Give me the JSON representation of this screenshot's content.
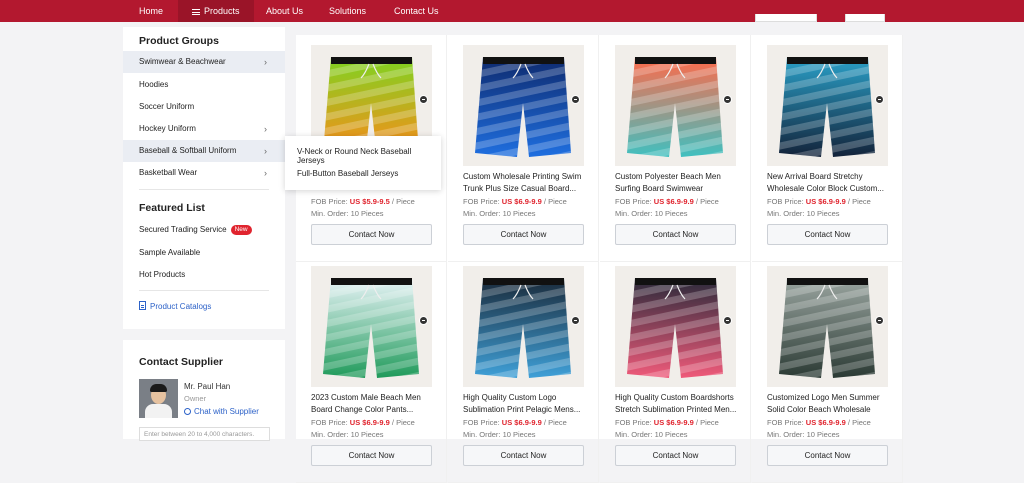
{
  "nav": {
    "items": [
      {
        "label": "Home",
        "active": false
      },
      {
        "label": "Products",
        "active": true
      },
      {
        "label": "About Us",
        "active": false
      },
      {
        "label": "Solutions",
        "active": false
      },
      {
        "label": "Contact Us",
        "active": false
      }
    ]
  },
  "sidebar": {
    "groups_title": "Product Groups",
    "groups": [
      {
        "label": "Swimwear & Beachwear",
        "has_sub": true
      },
      {
        "label": "Hoodies",
        "has_sub": false
      },
      {
        "label": "Soccer Uniform",
        "has_sub": false
      },
      {
        "label": "Hockey Uniform",
        "has_sub": true
      },
      {
        "label": "Baseball & Softball Uniform",
        "has_sub": true
      },
      {
        "label": "Basketball Wear",
        "has_sub": true
      }
    ],
    "flyout": [
      "V-Neck or Round Neck Baseball Jerseys",
      "Full-Button Baseball Jerseys"
    ],
    "featured_title": "Featured List",
    "featured": [
      {
        "label": "Secured Trading Service",
        "badge": "New"
      },
      {
        "label": "Sample Available",
        "badge": ""
      },
      {
        "label": "Hot Products",
        "badge": ""
      }
    ],
    "catalog_link": "Product Catalogs"
  },
  "contact": {
    "title": "Contact Supplier",
    "name": "Mr. Paul Han",
    "role": "Owner",
    "chat": "Chat with Supplier",
    "placeholder": "Enter between 20 to 4,000 characters."
  },
  "products": [
    {
      "title": "",
      "fob_label": "FOB Price:",
      "price": "US $5.9-9.5",
      "unit": "/ Piece",
      "moq": "Min. Order: 10 Pieces",
      "button": "Contact Now",
      "colors": [
        "#ff8a1a",
        "#7ed321"
      ]
    },
    {
      "title": "Custom Wholesale Printing Swim Trunk Plus Size Casual Board...",
      "fob_label": "FOB Price:",
      "price": "US $6.9-9.9",
      "unit": "/ Piece",
      "moq": "Min. Order: 10 Pieces",
      "button": "Contact Now",
      "colors": [
        "#1f6fe0",
        "#0e2a6e"
      ]
    },
    {
      "title": "Custom Polyester Beach Men Surfing Board Swimwear Swimsui...",
      "fob_label": "FOB Price:",
      "price": "US $6.9-9.9",
      "unit": "/ Piece",
      "moq": "Min. Order: 10 Pieces",
      "button": "Contact Now",
      "colors": [
        "#3fc0c0",
        "#ff6a4a"
      ]
    },
    {
      "title": "New Arrival Board Stretchy Wholesale Color Block Custom...",
      "fob_label": "FOB Price:",
      "price": "US $6.9-9.9",
      "unit": "/ Piece",
      "moq": "Min. Order: 10 Pieces",
      "button": "Contact Now",
      "colors": [
        "#13233a",
        "#2aa0c8"
      ]
    },
    {
      "title": "2023 Custom Male Beach Men Board Change Color Pants...",
      "fob_label": "FOB Price:",
      "price": "US $6.9-9.9",
      "unit": "/ Piece",
      "moq": "Min. Order: 10 Pieces",
      "button": "Contact Now",
      "colors": [
        "#1f9a5a",
        "#e8f4f8"
      ]
    },
    {
      "title": "High Quality Custom Logo Sublimation Print Pelagic Mens...",
      "fob_label": "FOB Price:",
      "price": "US $6.9-9.9",
      "unit": "/ Piece",
      "moq": "Min. Order: 10 Pieces",
      "button": "Contact Now",
      "colors": [
        "#3fa0d8",
        "#1a2a3a"
      ]
    },
    {
      "title": "High Quality Custom Boardshorts Stretch Sublimation Printed Men...",
      "fob_label": "FOB Price:",
      "price": "US $6.9-9.9",
      "unit": "/ Piece",
      "moq": "Min. Order: 10 Pieces",
      "button": "Contact Now",
      "colors": [
        "#f05a7a",
        "#2a2a3a"
      ]
    },
    {
      "title": "Customized Logo Men Summer Solid Color Beach Wholesale Quic...",
      "fob_label": "FOB Price:",
      "price": "US $6.9-9.9",
      "unit": "/ Piece",
      "moq": "Min. Order: 10 Pieces",
      "button": "Contact Now",
      "colors": [
        "#2b3a34",
        "#9aa5a0"
      ]
    }
  ]
}
